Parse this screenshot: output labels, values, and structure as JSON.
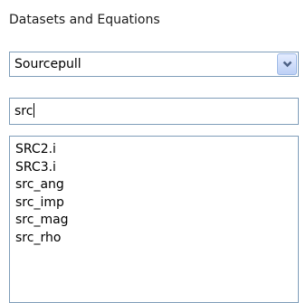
{
  "panel": {
    "title": "Datasets and Equations"
  },
  "dropdown": {
    "selected": "Sourcepull",
    "icon": "chevron-down-icon",
    "button_color": "#bdd0f5",
    "arrow_color": "#4d6185"
  },
  "search": {
    "value": "src"
  },
  "results": {
    "items": [
      "SRC2.i",
      "SRC3.i",
      "src_ang",
      "src_imp",
      "src_mag",
      "src_rho"
    ]
  }
}
